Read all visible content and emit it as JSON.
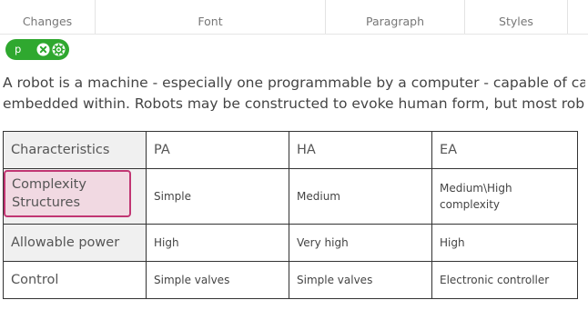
{
  "ribbon": {
    "groups": [
      "Changes",
      "Font",
      "Paragraph",
      "Styles"
    ]
  },
  "tag_path": {
    "label": "p",
    "remove_icon": "close-icon",
    "settings_icon": "gear-icon",
    "color": "#2fa82f"
  },
  "paragraph": {
    "line1": "A robot is a machine - especially one programmable by a computer - capable of carryin",
    "line2": "embedded within. Robots may be constructed to evoke human form, but most robots a"
  },
  "table": {
    "headers": [
      "Characteristics",
      "PA",
      "HA",
      "EA"
    ],
    "rows": [
      [
        "Complexity Structures",
        "Simple",
        "Medium",
        "Medium\\High complexity"
      ],
      [
        "Allowable power",
        "High",
        "Very high",
        "High"
      ],
      [
        "Control",
        "Simple valves",
        "Simple valves",
        "Electronic controller"
      ]
    ],
    "selection_color": "#c13673"
  }
}
